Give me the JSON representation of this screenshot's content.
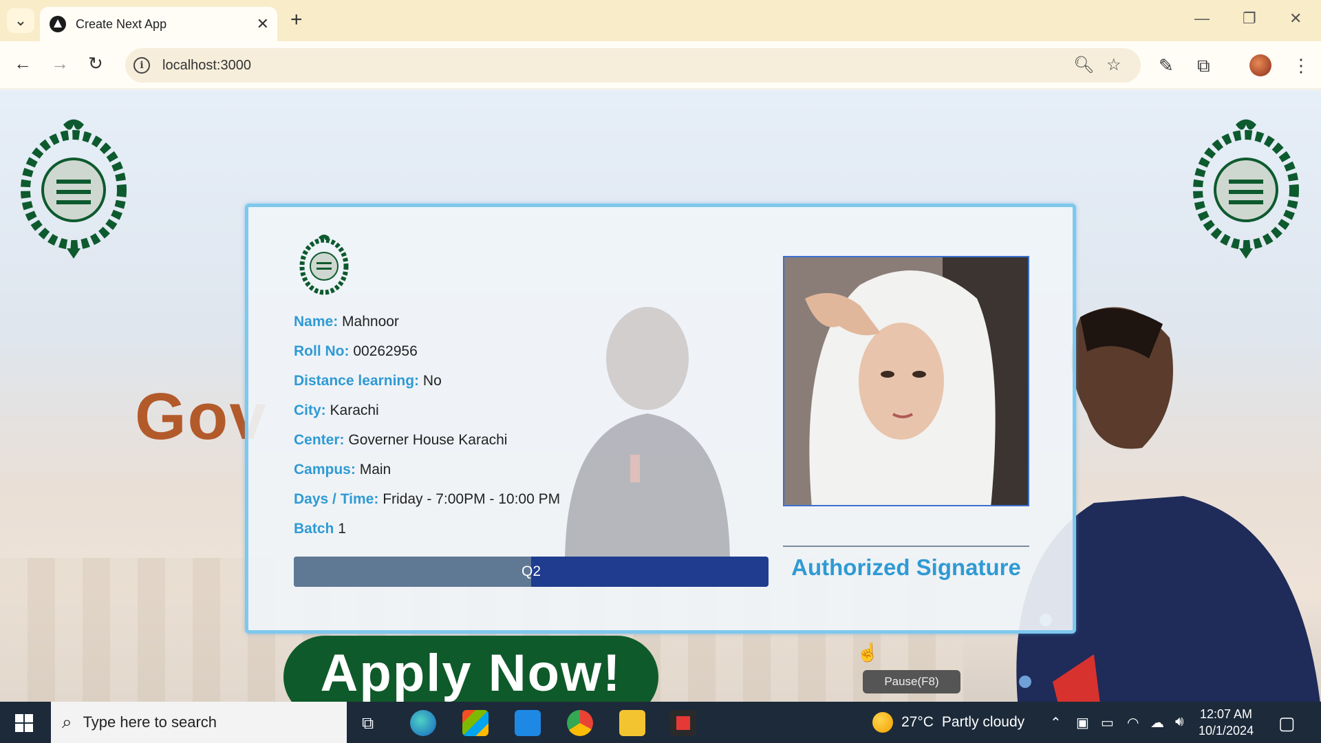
{
  "browser": {
    "tab_title": "Create Next App",
    "tab_close": "✕",
    "new_tab": "+",
    "url": "localhost:3000"
  },
  "page": {
    "background_text": "Gov",
    "apply_button": "Apply Now!",
    "tooltip": "Pause(F8)"
  },
  "card": {
    "fields": [
      {
        "key": "Name:",
        "value": "Mahnoor"
      },
      {
        "key": "Roll No:",
        "value": "00262956"
      },
      {
        "key": "Distance learning:",
        "value": "No"
      },
      {
        "key": "City:",
        "value": "Karachi"
      },
      {
        "key": "Center:",
        "value": "Governer House Karachi"
      },
      {
        "key": "Campus:",
        "value": "Main"
      },
      {
        "key": "Days / Time:",
        "value": "Friday - 7:00PM - 10:00 PM"
      },
      {
        "key": "Batch",
        "value": "1"
      }
    ],
    "quarter_label": "Q2",
    "quarter_progress": 0.5,
    "signature_label": "Authorized Signature"
  },
  "taskbar": {
    "search_placeholder": "Type here to search",
    "temperature": "27°C",
    "weather": "Partly cloudy",
    "time": "12:07 AM",
    "date": "10/1/2024"
  },
  "colors": {
    "label_blue": "#2f9ad4",
    "card_border": "#7ec8ee",
    "bar_dark": "#1f3c8f",
    "bar_fill": "#5f7894",
    "emblem_green": "#0d5a2e"
  }
}
